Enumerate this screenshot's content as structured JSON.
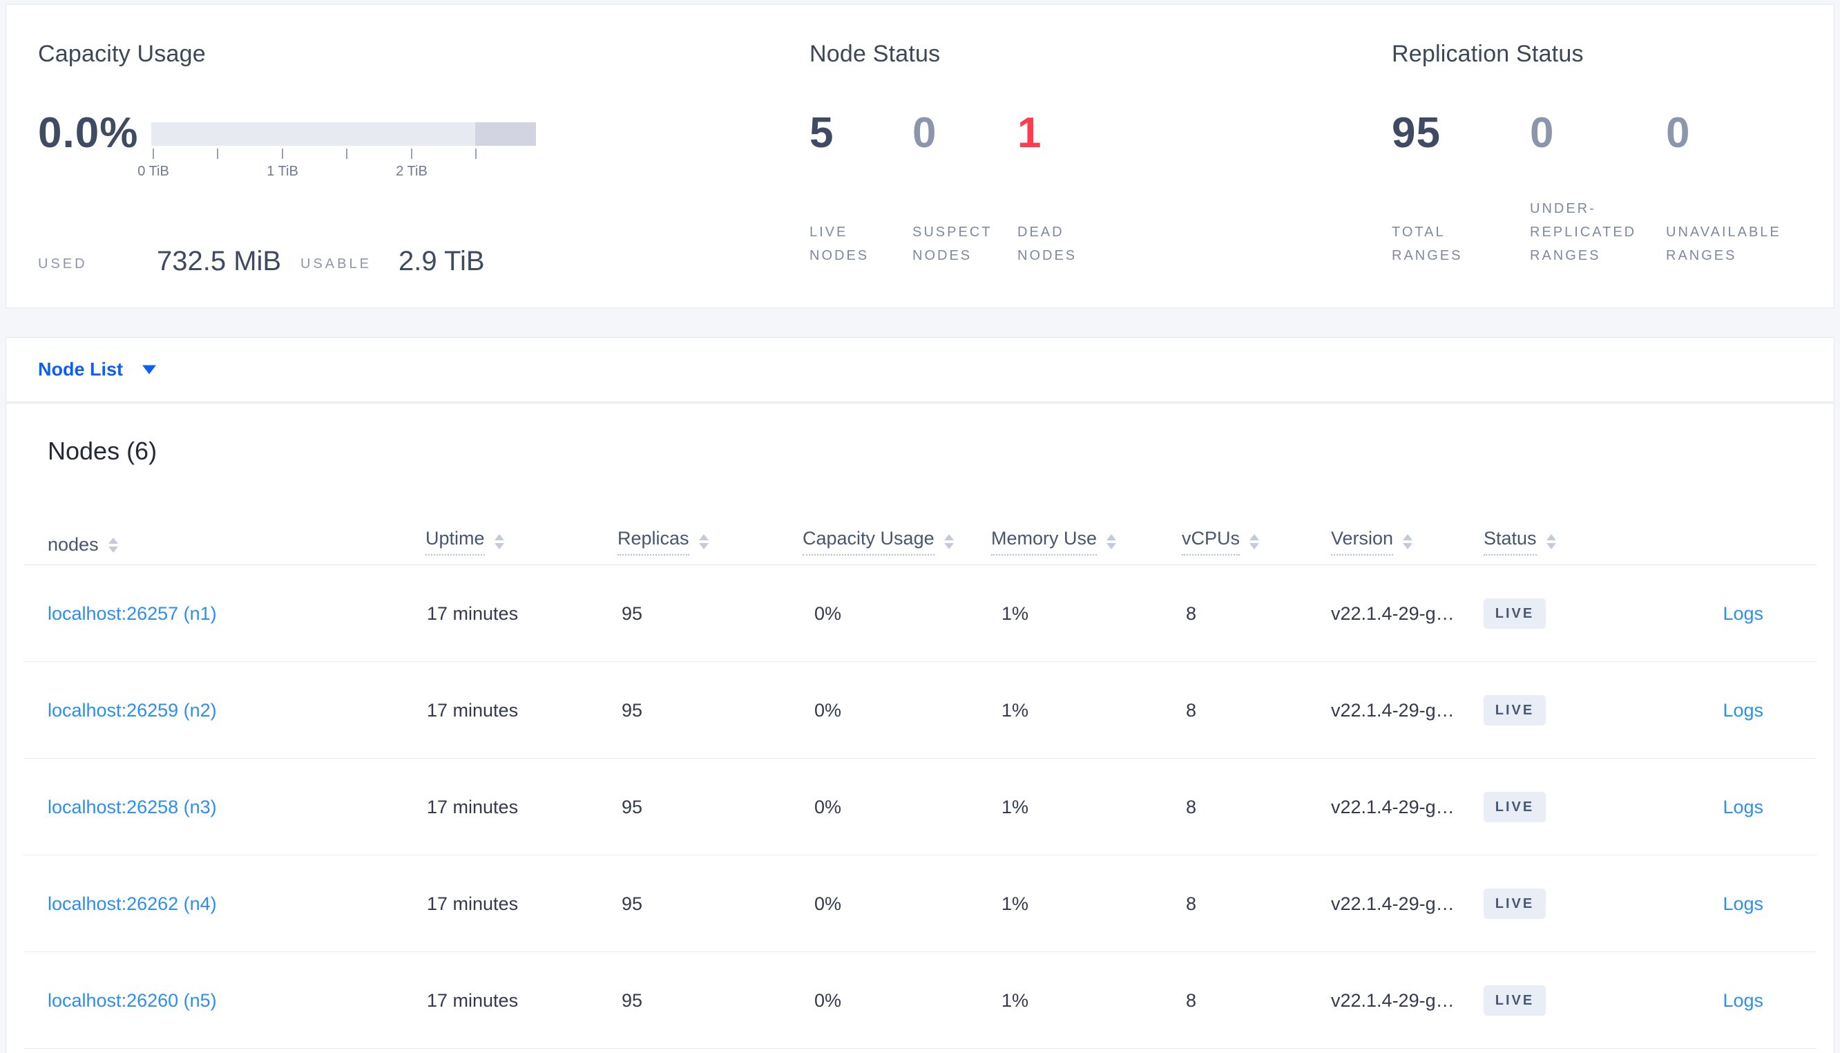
{
  "summary": {
    "capacity": {
      "title": "Capacity Usage",
      "percent_used": "0.0%",
      "used_label": "USED",
      "used_value": "732.5 MiB",
      "usable_label": "USABLE",
      "usable_value": "2.9 TiB",
      "tick_labels": [
        "0 TiB",
        "1 TiB",
        "2 TiB"
      ],
      "bar_track_color": "#e8eaf2",
      "bar_tail_color": "#d2d5e1"
    },
    "node_status": {
      "title": "Node Status",
      "stats": [
        {
          "value": "5",
          "label": "LIVE NODES",
          "color": "#3e4b63"
        },
        {
          "value": "0",
          "label": "SUSPECT NODES",
          "color": "#8b95ab"
        },
        {
          "value": "1",
          "label": "DEAD NODES",
          "color": "#ff3b4e"
        }
      ]
    },
    "replication": {
      "title": "Replication Status",
      "stats": [
        {
          "value": "95",
          "label": "TOTAL RANGES",
          "color": "#3e4b63"
        },
        {
          "value": "0",
          "label": "UNDER-REPLICATED RANGES",
          "color": "#8b95ab"
        },
        {
          "value": "0",
          "label": "UNAVAILABLE RANGES",
          "color": "#8b95ab"
        }
      ]
    }
  },
  "view_selector": {
    "label": "Node List"
  },
  "nodes_section": {
    "heading": "Nodes (6)",
    "columns": [
      "nodes",
      "Uptime",
      "Replicas",
      "Capacity Usage",
      "Memory Use",
      "vCPUs",
      "Version",
      "Status"
    ],
    "link_color": "#2b8ef2",
    "badge_bg": "#e9edf5",
    "rows": [
      {
        "address": "localhost:26257 (n1)",
        "uptime": "17 minutes",
        "replicas": "95",
        "capacity_usage": "0%",
        "memory_use": "1%",
        "vcpus": "8",
        "version": "v22.1.4-29-g…",
        "status": "LIVE",
        "logs": "Logs"
      },
      {
        "address": "localhost:26259 (n2)",
        "uptime": "17 minutes",
        "replicas": "95",
        "capacity_usage": "0%",
        "memory_use": "1%",
        "vcpus": "8",
        "version": "v22.1.4-29-g…",
        "status": "LIVE",
        "logs": "Logs"
      },
      {
        "address": "localhost:26258 (n3)",
        "uptime": "17 minutes",
        "replicas": "95",
        "capacity_usage": "0%",
        "memory_use": "1%",
        "vcpus": "8",
        "version": "v22.1.4-29-g…",
        "status": "LIVE",
        "logs": "Logs"
      },
      {
        "address": "localhost:26262 (n4)",
        "uptime": "17 minutes",
        "replicas": "95",
        "capacity_usage": "0%",
        "memory_use": "1%",
        "vcpus": "8",
        "version": "v22.1.4-29-g…",
        "status": "LIVE",
        "logs": "Logs"
      },
      {
        "address": "localhost:26260 (n5)",
        "uptime": "17 minutes",
        "replicas": "95",
        "capacity_usage": "0%",
        "memory_use": "1%",
        "vcpus": "8",
        "version": "v22.1.4-29-g…",
        "status": "LIVE",
        "logs": "Logs"
      }
    ]
  }
}
